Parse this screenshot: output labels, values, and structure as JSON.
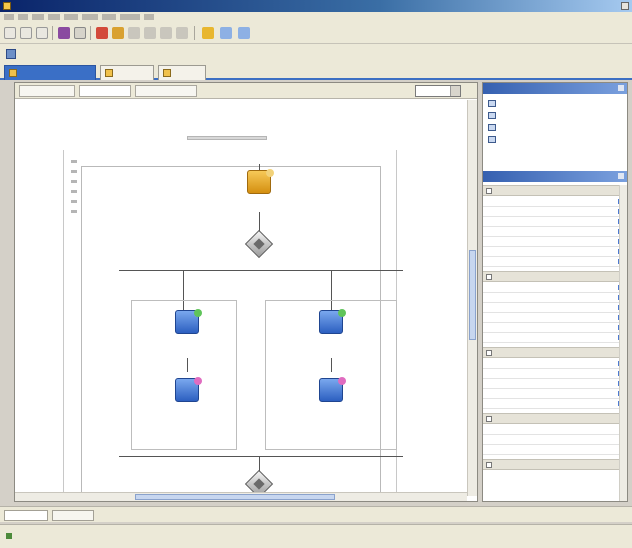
{
  "window": {
    "title": ""
  },
  "menu": {
    "items": [
      "",
      "",
      "",
      "",
      "",
      "",
      "",
      "",
      ""
    ]
  },
  "nav": {
    "label": ""
  },
  "file_tabs": [
    {
      "label": ""
    },
    {
      "label": ""
    },
    {
      "label": ""
    }
  ],
  "editor": {
    "subtabs": [
      {
        "label": ""
      },
      {
        "label": ""
      },
      {
        "label": ""
      }
    ],
    "zoom_label": "",
    "zoom_value": ""
  },
  "diagram": {
    "receive": {
      "caption": ""
    },
    "switch_top": {
      "caption": ""
    },
    "left_invoke_1": {
      "caption_1": "",
      "caption_2": ""
    },
    "left_invoke_2": {
      "caption_1": "",
      "caption_2": ""
    },
    "right_invoke_1": {
      "caption_1": "",
      "caption_2": ""
    },
    "right_invoke_2": {
      "caption_1": "",
      "caption_2": ""
    },
    "switch_bottom": {
      "caption": ""
    }
  },
  "structure_pane": {
    "title": "",
    "items": [
      {
        "label": ""
      },
      {
        "label": ""
      },
      {
        "label": ""
      },
      {
        "label": ""
      },
      {
        "label": ""
      }
    ]
  },
  "properties_pane": {
    "title": "",
    "sections": [
      {
        "label": "",
        "rows": [
          {
            "key": "",
            "value": ""
          },
          {
            "key": "",
            "value": ""
          },
          {
            "key": "",
            "value": ""
          },
          {
            "key": "",
            "value": ""
          },
          {
            "key": "",
            "value": ""
          },
          {
            "key": "",
            "value": ""
          },
          {
            "key": "",
            "value": ""
          }
        ]
      },
      {
        "label": "",
        "rows": [
          {
            "key": "",
            "value": ""
          },
          {
            "key": "",
            "value": ""
          },
          {
            "key": "",
            "value": ""
          },
          {
            "key": "",
            "value": ""
          },
          {
            "key": "",
            "value": ""
          },
          {
            "key": "",
            "value": ""
          }
        ]
      },
      {
        "label": "",
        "rows": [
          {
            "key": "",
            "value": ""
          },
          {
            "key": "",
            "value": ""
          },
          {
            "key": "",
            "value": ""
          },
          {
            "key": "",
            "value": ""
          },
          {
            "key": "",
            "value": ""
          }
        ]
      },
      {
        "label": "",
        "rows": [
          {
            "key": "",
            "value": ""
          },
          {
            "key": "",
            "value": ""
          },
          {
            "key": "",
            "value": ""
          }
        ]
      },
      {
        "label": "",
        "rows": []
      }
    ]
  },
  "bottom_tabs": [
    {
      "label": ""
    },
    {
      "label": ""
    }
  ],
  "status": {
    "text": ""
  },
  "colors": {
    "title_bar": "#0a246a",
    "accent": "#3a6fc6",
    "receive": "#f0b43a",
    "invoke": "#3f74d4",
    "chrome": "#ece9d8"
  },
  "icons": {
    "receive": "inbox-icon",
    "invoke": "service-invoke-icon",
    "switch": "diamond-switch-icon",
    "structure_item": "variable-icon",
    "edit": "pencil-icon"
  }
}
